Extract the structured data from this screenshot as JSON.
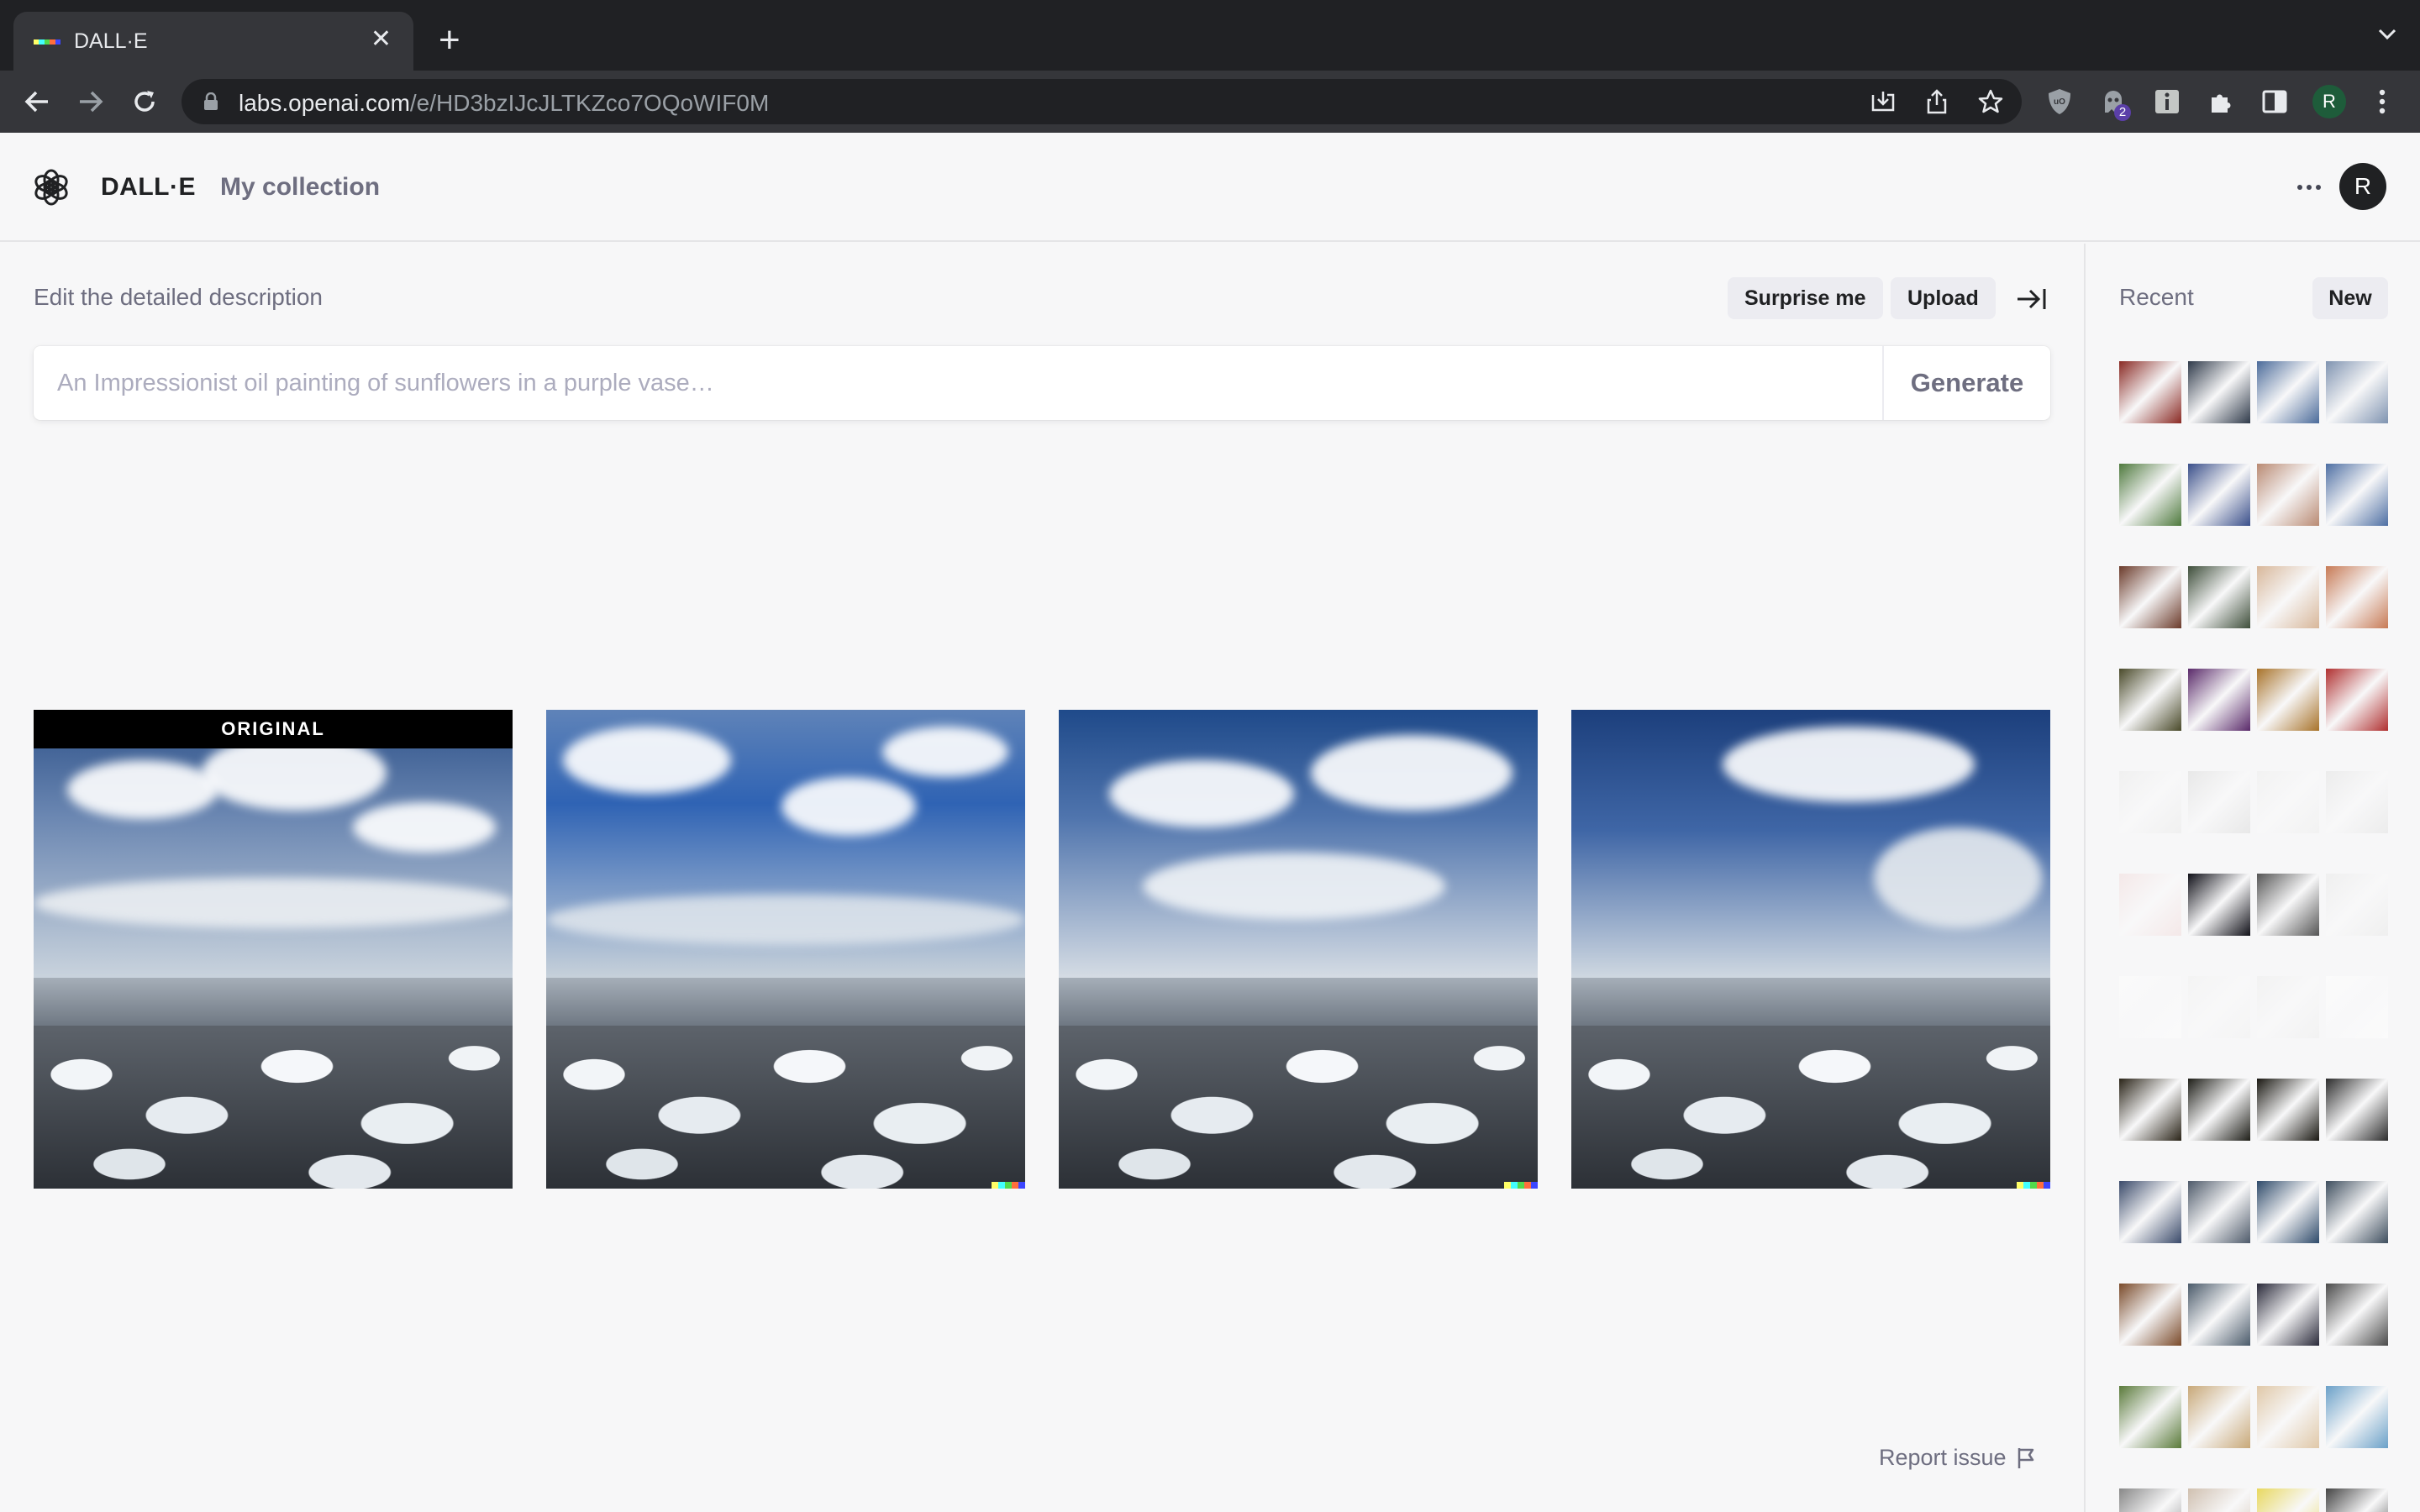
{
  "browser": {
    "tab_title": "DALL·E",
    "tab_close": "✕",
    "new_tab": "+",
    "url_host": "labs.openai.com",
    "url_path": "/e/HD3bzIJcJLTKZco7OQoWIF0M",
    "extension_badge": "2",
    "profile_initial": "R"
  },
  "header": {
    "brand": "DALL·E",
    "collection_link": "My collection",
    "user_initial": "R"
  },
  "editor": {
    "label": "Edit the detailed description",
    "surprise_label": "Surprise me",
    "upload_label": "Upload",
    "prompt_placeholder": "An Impressionist oil painting of sunflowers in a purple vase…",
    "prompt_value": "",
    "generate_label": "Generate"
  },
  "results": {
    "original_label": "ORIGINAL",
    "report_label": "Report issue"
  },
  "sidebar": {
    "recent_label": "Recent",
    "new_label": "New"
  },
  "colors": {
    "dalle_mark": [
      "#ffff66",
      "#42ffff",
      "#51da4c",
      "#ff6e3c",
      "#3c46ff"
    ],
    "sky_top": "#2b4f8c",
    "sky_bottom": "#c9d3dd"
  }
}
